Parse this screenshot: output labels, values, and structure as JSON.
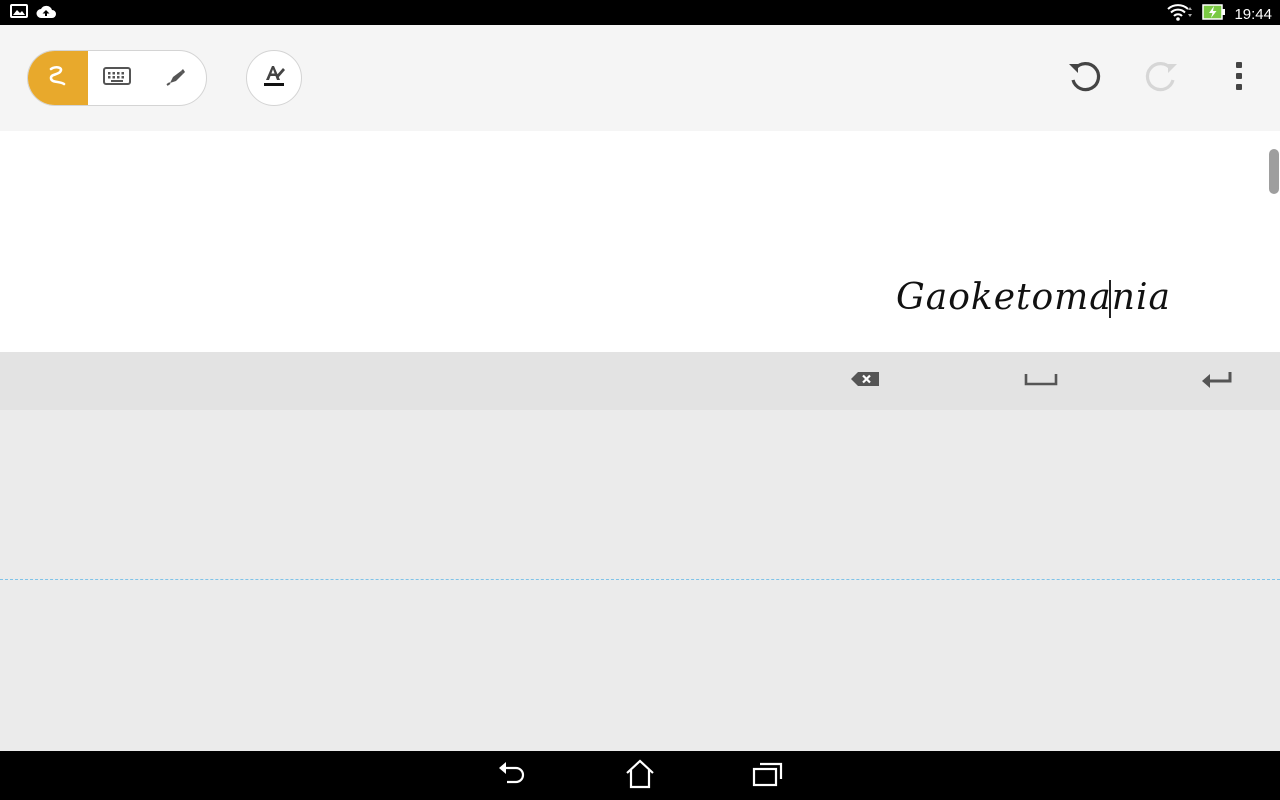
{
  "status_bar": {
    "time": "19:44",
    "icons": [
      "gallery-icon",
      "cloud-upload-icon",
      "wifi-icon",
      "battery-charging-icon"
    ]
  },
  "toolbar": {
    "modes": [
      {
        "name": "handwriting-mode",
        "icon": "handwriting-icon",
        "active": true
      },
      {
        "name": "keyboard-mode",
        "icon": "keyboard-icon",
        "active": false
      },
      {
        "name": "pen-mode",
        "icon": "pen-icon",
        "active": false
      }
    ],
    "format_icon": "text-format-icon",
    "undo_icon": "undo-icon",
    "redo_icon": "redo-icon",
    "redo_enabled": false,
    "menu_icon": "more-vert-icon"
  },
  "text_area": {
    "content": "Gaoketomania"
  },
  "key_bar": {
    "keys": [
      "backspace-icon",
      "space-icon",
      "enter-icon"
    ]
  },
  "nav_bar": {
    "buttons": [
      "back-icon",
      "home-icon",
      "recents-icon"
    ]
  },
  "colors": {
    "accent": "#e8a92c",
    "guide_line": "#7fc3e8",
    "icon_dark": "#555555",
    "icon_disabled": "#d6d6d6"
  }
}
